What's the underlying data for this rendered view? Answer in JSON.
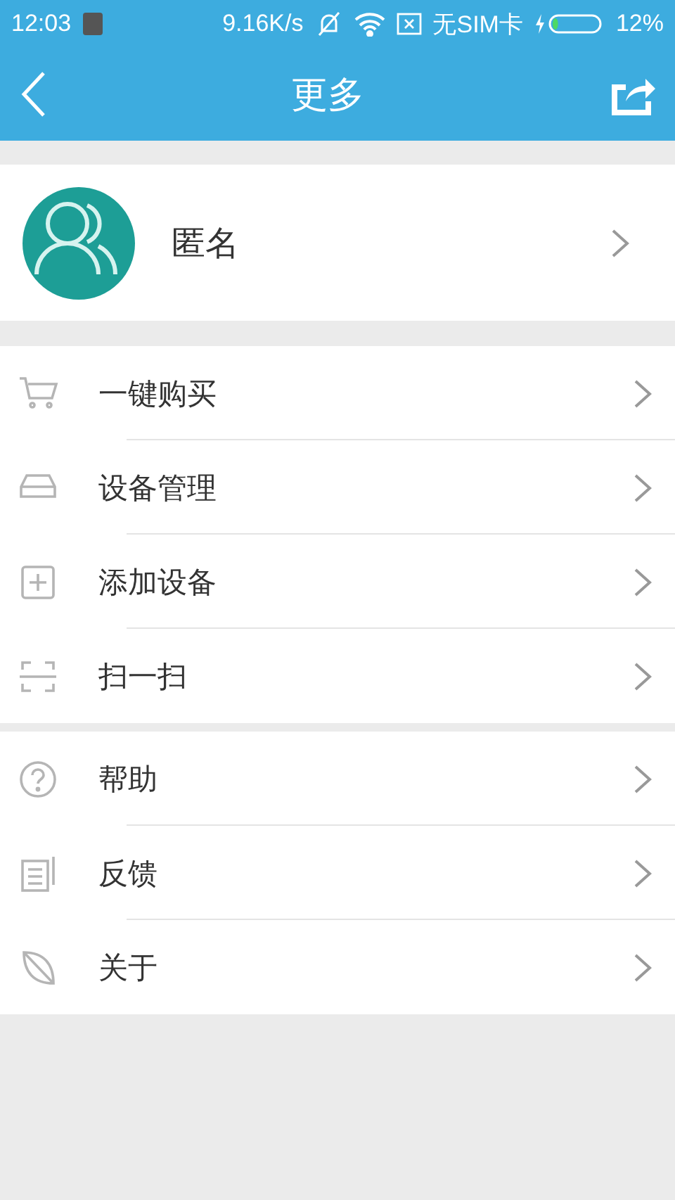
{
  "status_bar": {
    "time": "12:03",
    "speed": "9.16K/s",
    "sim": "无SIM卡",
    "battery": {
      "text": "12%",
      "level": 0.12
    }
  },
  "header": {
    "title": "更多"
  },
  "profile": {
    "name": "匿名"
  },
  "groups": [
    {
      "items": [
        {
          "kind": "cart",
          "label": "一键购买"
        },
        {
          "kind": "device",
          "label": "设备管理"
        },
        {
          "kind": "add",
          "label": "添加设备"
        },
        {
          "kind": "scan",
          "label": "扫一扫"
        }
      ]
    },
    {
      "items": [
        {
          "kind": "help",
          "label": "帮助"
        },
        {
          "kind": "feedback",
          "label": "反馈"
        },
        {
          "kind": "about",
          "label": "关于"
        }
      ]
    }
  ]
}
